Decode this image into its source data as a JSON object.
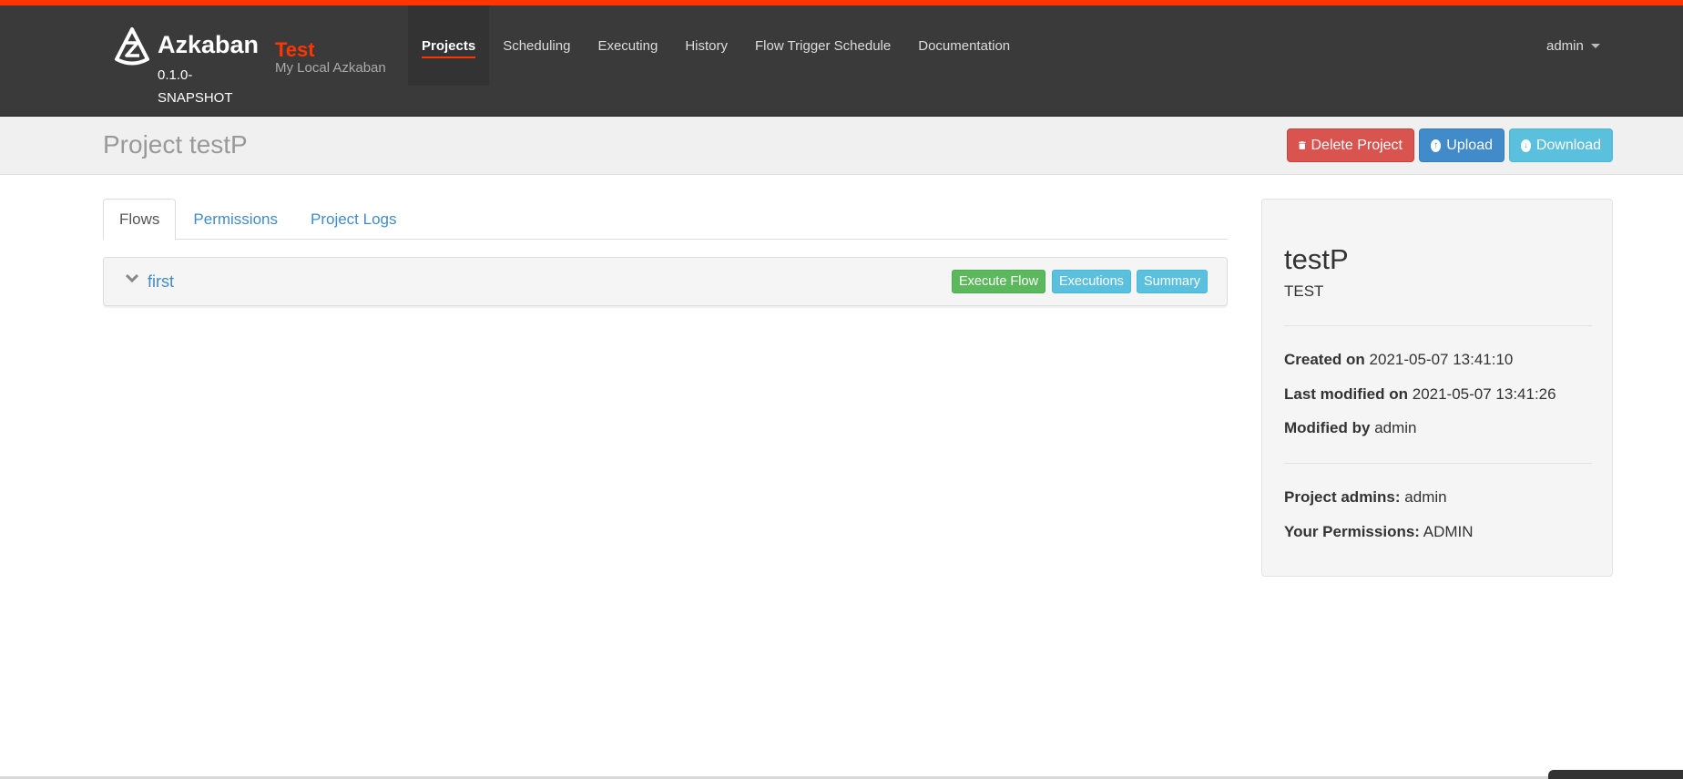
{
  "brand": {
    "name": "Azkaban",
    "version": "0.1.0-SNAPSHOT",
    "env_name": "Test",
    "env_desc": "My Local Azkaban"
  },
  "nav": {
    "items": [
      {
        "label": "Projects",
        "active": true
      },
      {
        "label": "Scheduling",
        "active": false
      },
      {
        "label": "Executing",
        "active": false
      },
      {
        "label": "History",
        "active": false
      },
      {
        "label": "Flow Trigger Schedule",
        "active": false
      },
      {
        "label": "Documentation",
        "active": false
      }
    ],
    "user": "admin"
  },
  "header": {
    "title": "Project testP",
    "buttons": {
      "delete": "Delete Project",
      "upload": "Upload",
      "download": "Download"
    }
  },
  "tabs": [
    {
      "label": "Flows",
      "active": true
    },
    {
      "label": "Permissions",
      "active": false
    },
    {
      "label": "Project Logs",
      "active": false
    }
  ],
  "flows": [
    {
      "name": "first",
      "buttons": {
        "execute": "Execute Flow",
        "executions": "Executions",
        "summary": "Summary"
      }
    }
  ],
  "project": {
    "name": "testP",
    "description": "TEST",
    "created_label": "Created on",
    "created_value": "2021-05-07 13:41:10",
    "modified_label": "Last modified on",
    "modified_value": "2021-05-07 13:41:26",
    "modified_by_label": "Modified by",
    "modified_by_value": "admin",
    "admins_label": "Project admins:",
    "admins_value": "admin",
    "permissions_label": "Your Permissions:",
    "permissions_value": "ADMIN"
  },
  "colors": {
    "accent": "#ff3601",
    "navbar": "#3a3a3a",
    "danger": "#d9534f",
    "primary": "#428bca",
    "info": "#5bc0de",
    "success": "#5cb85c"
  }
}
